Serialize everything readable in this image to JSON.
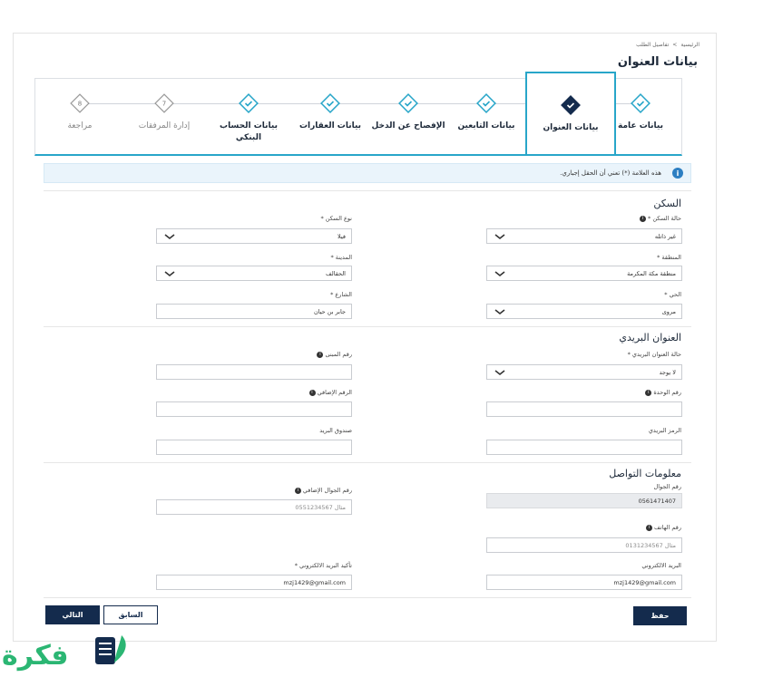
{
  "breadcrumb": {
    "home": "الرئيسية",
    "separator": ">",
    "current": "تفاصيل الطلب"
  },
  "page_title": "بيانات العنوان",
  "steps": [
    {
      "label": "بيانات عامة",
      "state": "done"
    },
    {
      "label": "بيانات العنوان",
      "state": "active"
    },
    {
      "label": "بيانات التابعين",
      "state": "done"
    },
    {
      "label": "الإفصاح عن الدخل",
      "state": "done"
    },
    {
      "label": "بيانات العقارات",
      "state": "done"
    },
    {
      "label": "بيانات الحساب البنكي",
      "state": "done"
    },
    {
      "label": "إدارة المرفقات",
      "state": "pending",
      "number": "7"
    },
    {
      "label": "مراجعة",
      "state": "pending",
      "number": "8"
    }
  ],
  "info_bar": {
    "icon": "info-icon",
    "text": "هذه العلامة (*) تعني أن الحقل إجباري."
  },
  "housing": {
    "title": "السكن",
    "housing_status": {
      "label": "حالة السكن *",
      "value": "غير ذاتله"
    },
    "housing_type": {
      "label": "نوع السكن *",
      "value": "فيلا"
    },
    "region": {
      "label": "المنطقة *",
      "value": "منطقة مكة المكرمة"
    },
    "city": {
      "label": "المدينة *",
      "value": "الحقالف"
    },
    "district": {
      "label": "الحي *",
      "value": "مروى"
    },
    "street": {
      "label": "الشارع *",
      "value": "جابر بن حيان"
    }
  },
  "postal": {
    "title": "العنوان البريدي",
    "postal_status": {
      "label": "حالة العنوان البريدي *",
      "value": "لا يوجد"
    },
    "building_number": {
      "label": "رقم المبنى",
      "value": ""
    },
    "unit_number": {
      "label": "رقم الوحدة",
      "value": ""
    },
    "additional_number": {
      "label": "الرقم الإضافي",
      "value": ""
    },
    "postal_code": {
      "label": "الرمز البريدي",
      "value": ""
    },
    "po_box": {
      "label": "صندوق البريد",
      "value": ""
    }
  },
  "contact": {
    "title": "معلومات التواصل",
    "mobile": {
      "label": "رقم الجوال",
      "value": "0561471407"
    },
    "extra_mobile": {
      "label": "رقم الجوال الإضافي",
      "placeholder": "مثال 0551234567"
    },
    "phone": {
      "label": "رقم الهاتف",
      "placeholder": "مثال 0131234567"
    },
    "email": {
      "label": "البريد الالكتروني",
      "value": "mzj1429@gmail.com"
    },
    "email_confirm": {
      "label": "تأكيد البريد الالكتروني *",
      "value": "mzj1429@gmail.com"
    }
  },
  "buttons": {
    "save": "حفظ",
    "previous": "السابق",
    "next": "التالي"
  },
  "logo": {
    "text": "فكرة"
  },
  "colors": {
    "accent": "#28a6c9",
    "primary": "#142b4d",
    "logo_green": "#2bb673"
  }
}
